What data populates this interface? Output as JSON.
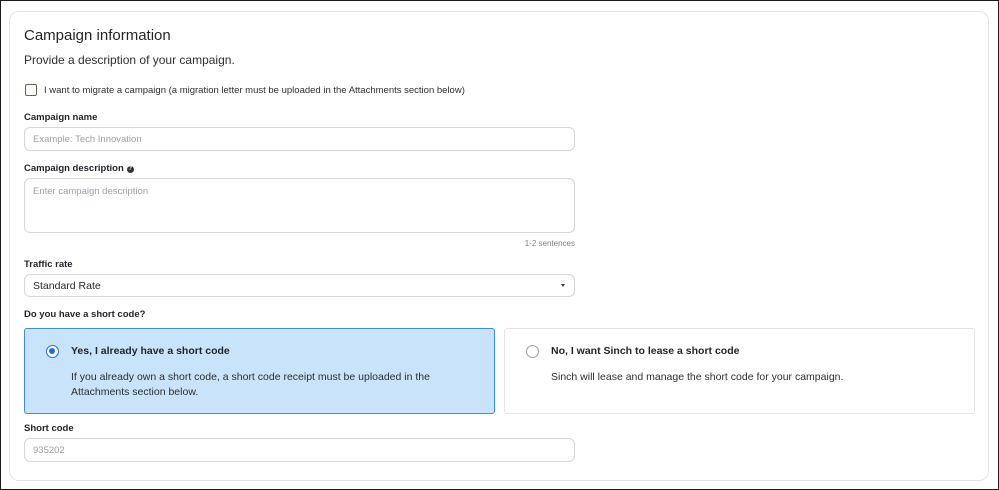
{
  "section": {
    "title": "Campaign information",
    "subtitle": "Provide a description of your campaign."
  },
  "migrate": {
    "label": "I want to migrate a campaign (a migration letter must be uploaded in the Attachments section below)",
    "checked": false
  },
  "campaign_name": {
    "label": "Campaign name",
    "placeholder": "Example: Tech Innovation",
    "value": ""
  },
  "campaign_description": {
    "label": "Campaign description",
    "help_icon": "question-circle-icon",
    "placeholder": "Enter campaign description",
    "hint": "1-2 sentences"
  },
  "traffic_rate": {
    "label": "Traffic rate",
    "value": "Standard Rate",
    "caret_icon": "caret-down-icon"
  },
  "short_code_question": {
    "label": "Do you have a short code?",
    "options": [
      {
        "title": "Yes, I already have a short code",
        "description": "If you already own a short code, a short code receipt must be uploaded in the Attachments section below.",
        "selected": true
      },
      {
        "title": "No, I want Sinch to lease a short code",
        "description": "Sinch will lease and manage the short code for your campaign.",
        "selected": false
      }
    ]
  },
  "short_code": {
    "label": "Short code",
    "placeholder": "935202",
    "value": ""
  },
  "colors": {
    "selected_bg": "#c9e3fa",
    "selected_border": "#3b8fd9",
    "radio_accent": "#1e6fd0"
  }
}
